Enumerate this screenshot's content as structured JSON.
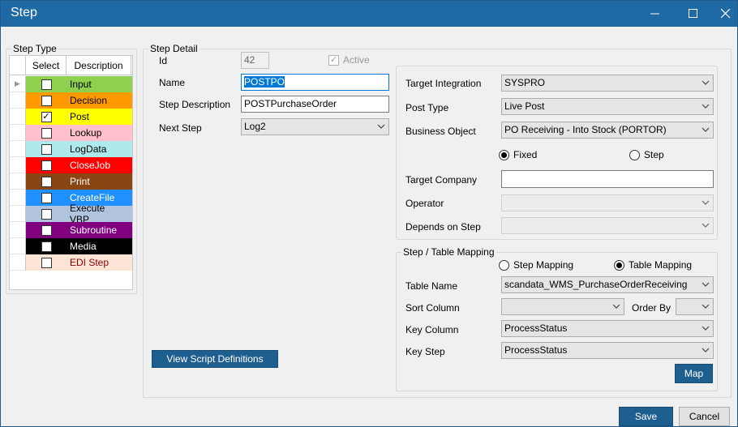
{
  "window": {
    "title": "Step",
    "minimize_icon": "minimize-icon",
    "maximize_icon": "maximize-icon",
    "close_icon": "close-icon"
  },
  "step_type": {
    "legend": "Step Type",
    "col_select": "Select",
    "col_description": "Description",
    "rows": [
      {
        "label": "Input",
        "checked": false,
        "bg": "#8fd14f",
        "fg": "#000000"
      },
      {
        "label": "Decision",
        "checked": false,
        "bg": "#ff9a00",
        "fg": "#000000"
      },
      {
        "label": "Post",
        "checked": true,
        "bg": "#ffff00",
        "fg": "#000000"
      },
      {
        "label": "Lookup",
        "checked": false,
        "bg": "#ffc0cb",
        "fg": "#000000"
      },
      {
        "label": "LogData",
        "checked": false,
        "bg": "#aee9ee",
        "fg": "#000000"
      },
      {
        "label": "CloseJob",
        "checked": false,
        "bg": "#ff0000",
        "fg": "#ffffff"
      },
      {
        "label": "Print",
        "checked": false,
        "bg": "#8b4513",
        "fg": "#ffffff"
      },
      {
        "label": "CreateFile",
        "checked": false,
        "bg": "#1e90ff",
        "fg": "#ffffff"
      },
      {
        "label": "Execute VBP",
        "checked": false,
        "bg": "#b0c4de",
        "fg": "#000000"
      },
      {
        "label": "Subroutine",
        "checked": false,
        "bg": "#800080",
        "fg": "#ffffff"
      },
      {
        "label": "Media",
        "checked": false,
        "bg": "#000000",
        "fg": "#ffffff"
      },
      {
        "label": "EDI Step",
        "checked": false,
        "bg": "#fce4d6",
        "fg": "#8b0000"
      }
    ]
  },
  "step_detail": {
    "legend": "Step Detail",
    "id_label": "Id",
    "id_value": "42",
    "active_label": "Active",
    "active_checked": true,
    "name_label": "Name",
    "name_value": "POSTPO",
    "desc_label": "Step Description",
    "desc_value": "POSTPurchaseOrder",
    "next_label": "Next Step",
    "next_value": "Log2",
    "view_script_button": "View Script Definitions"
  },
  "target": {
    "integration_label": "Target Integration",
    "integration_value": "SYSPRO",
    "post_type_label": "Post Type",
    "post_type_value": "Live Post",
    "business_object_label": "Business Object",
    "business_object_value": "PO Receiving - Into Stock (PORTOR)",
    "fixed_label": "Fixed",
    "fixed_selected": true,
    "step_label": "Step",
    "step_selected": false,
    "company_label": "Target Company",
    "company_value": "",
    "operator_label": "Operator",
    "operator_value": "",
    "depends_label": "Depends on Step",
    "depends_value": ""
  },
  "mapping": {
    "legend": "Step / Table Mapping",
    "step_mapping_label": "Step Mapping",
    "step_mapping_selected": false,
    "table_mapping_label": "Table Mapping",
    "table_mapping_selected": true,
    "table_name_label": "Table Name",
    "table_name_value": "scandata_WMS_PurchaseOrderReceiving",
    "sort_column_label": "Sort Column",
    "sort_column_value": "",
    "order_by_label": "Order By",
    "order_by_value": "",
    "key_column_label": "Key Column",
    "key_column_value": "ProcessStatus",
    "key_step_label": "Key Step",
    "key_step_value": "ProcessStatus",
    "map_button": "Map"
  },
  "footer": {
    "save_button": "Save",
    "cancel_button": "Cancel"
  }
}
